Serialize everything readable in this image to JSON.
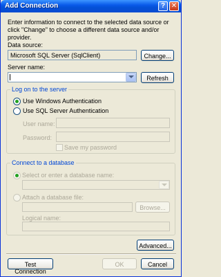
{
  "window": {
    "title": "Add Connection",
    "help_icon": "?",
    "close_icon": "✕"
  },
  "description": "Enter information to connect to the selected data source or click \"Change\" to choose a different data source and/or provider.",
  "data_source": {
    "label": "Data source:",
    "value": "Microsoft SQL Server (SqlClient)",
    "change_button": "Change..."
  },
  "server": {
    "label": "Server name:",
    "value": "",
    "refresh_button": "Refresh"
  },
  "logon": {
    "group_label": "Log on to the server",
    "windows_auth": "Use Windows Authentication",
    "sql_auth": "Use SQL Server Authentication",
    "user_name_label": "User name:",
    "password_label": "Password:",
    "save_password": "Save my password",
    "selected": "windows"
  },
  "database": {
    "group_label": "Connect to a database",
    "select_label": "Select or enter a database name:",
    "attach_label": "Attach a database file:",
    "browse_button": "Browse...",
    "logical_name_label": "Logical name:"
  },
  "buttons": {
    "advanced": "Advanced...",
    "test": "Test Connection",
    "ok": "OK",
    "cancel": "Cancel"
  }
}
